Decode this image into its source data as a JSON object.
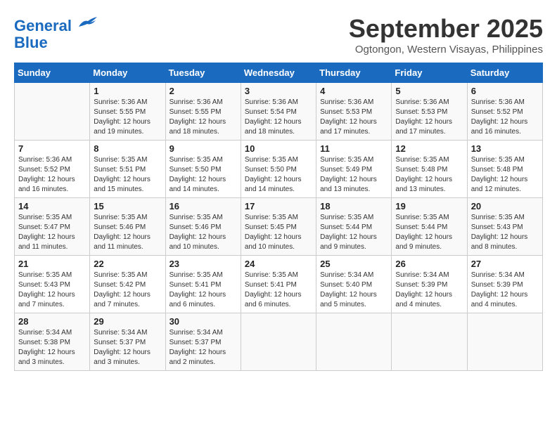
{
  "header": {
    "logo_line1": "General",
    "logo_line2": "Blue",
    "month_title": "September 2025",
    "location": "Ogtongon, Western Visayas, Philippines"
  },
  "days_of_week": [
    "Sunday",
    "Monday",
    "Tuesday",
    "Wednesday",
    "Thursday",
    "Friday",
    "Saturday"
  ],
  "weeks": [
    [
      {
        "day": "",
        "info": ""
      },
      {
        "day": "1",
        "info": "Sunrise: 5:36 AM\nSunset: 5:55 PM\nDaylight: 12 hours\nand 19 minutes."
      },
      {
        "day": "2",
        "info": "Sunrise: 5:36 AM\nSunset: 5:55 PM\nDaylight: 12 hours\nand 18 minutes."
      },
      {
        "day": "3",
        "info": "Sunrise: 5:36 AM\nSunset: 5:54 PM\nDaylight: 12 hours\nand 18 minutes."
      },
      {
        "day": "4",
        "info": "Sunrise: 5:36 AM\nSunset: 5:53 PM\nDaylight: 12 hours\nand 17 minutes."
      },
      {
        "day": "5",
        "info": "Sunrise: 5:36 AM\nSunset: 5:53 PM\nDaylight: 12 hours\nand 17 minutes."
      },
      {
        "day": "6",
        "info": "Sunrise: 5:36 AM\nSunset: 5:52 PM\nDaylight: 12 hours\nand 16 minutes."
      }
    ],
    [
      {
        "day": "7",
        "info": "Sunrise: 5:36 AM\nSunset: 5:52 PM\nDaylight: 12 hours\nand 16 minutes."
      },
      {
        "day": "8",
        "info": "Sunrise: 5:35 AM\nSunset: 5:51 PM\nDaylight: 12 hours\nand 15 minutes."
      },
      {
        "day": "9",
        "info": "Sunrise: 5:35 AM\nSunset: 5:50 PM\nDaylight: 12 hours\nand 14 minutes."
      },
      {
        "day": "10",
        "info": "Sunrise: 5:35 AM\nSunset: 5:50 PM\nDaylight: 12 hours\nand 14 minutes."
      },
      {
        "day": "11",
        "info": "Sunrise: 5:35 AM\nSunset: 5:49 PM\nDaylight: 12 hours\nand 13 minutes."
      },
      {
        "day": "12",
        "info": "Sunrise: 5:35 AM\nSunset: 5:48 PM\nDaylight: 12 hours\nand 13 minutes."
      },
      {
        "day": "13",
        "info": "Sunrise: 5:35 AM\nSunset: 5:48 PM\nDaylight: 12 hours\nand 12 minutes."
      }
    ],
    [
      {
        "day": "14",
        "info": "Sunrise: 5:35 AM\nSunset: 5:47 PM\nDaylight: 12 hours\nand 11 minutes."
      },
      {
        "day": "15",
        "info": "Sunrise: 5:35 AM\nSunset: 5:46 PM\nDaylight: 12 hours\nand 11 minutes."
      },
      {
        "day": "16",
        "info": "Sunrise: 5:35 AM\nSunset: 5:46 PM\nDaylight: 12 hours\nand 10 minutes."
      },
      {
        "day": "17",
        "info": "Sunrise: 5:35 AM\nSunset: 5:45 PM\nDaylight: 12 hours\nand 10 minutes."
      },
      {
        "day": "18",
        "info": "Sunrise: 5:35 AM\nSunset: 5:44 PM\nDaylight: 12 hours\nand 9 minutes."
      },
      {
        "day": "19",
        "info": "Sunrise: 5:35 AM\nSunset: 5:44 PM\nDaylight: 12 hours\nand 9 minutes."
      },
      {
        "day": "20",
        "info": "Sunrise: 5:35 AM\nSunset: 5:43 PM\nDaylight: 12 hours\nand 8 minutes."
      }
    ],
    [
      {
        "day": "21",
        "info": "Sunrise: 5:35 AM\nSunset: 5:43 PM\nDaylight: 12 hours\nand 7 minutes."
      },
      {
        "day": "22",
        "info": "Sunrise: 5:35 AM\nSunset: 5:42 PM\nDaylight: 12 hours\nand 7 minutes."
      },
      {
        "day": "23",
        "info": "Sunrise: 5:35 AM\nSunset: 5:41 PM\nDaylight: 12 hours\nand 6 minutes."
      },
      {
        "day": "24",
        "info": "Sunrise: 5:35 AM\nSunset: 5:41 PM\nDaylight: 12 hours\nand 6 minutes."
      },
      {
        "day": "25",
        "info": "Sunrise: 5:34 AM\nSunset: 5:40 PM\nDaylight: 12 hours\nand 5 minutes."
      },
      {
        "day": "26",
        "info": "Sunrise: 5:34 AM\nSunset: 5:39 PM\nDaylight: 12 hours\nand 4 minutes."
      },
      {
        "day": "27",
        "info": "Sunrise: 5:34 AM\nSunset: 5:39 PM\nDaylight: 12 hours\nand 4 minutes."
      }
    ],
    [
      {
        "day": "28",
        "info": "Sunrise: 5:34 AM\nSunset: 5:38 PM\nDaylight: 12 hours\nand 3 minutes."
      },
      {
        "day": "29",
        "info": "Sunrise: 5:34 AM\nSunset: 5:37 PM\nDaylight: 12 hours\nand 3 minutes."
      },
      {
        "day": "30",
        "info": "Sunrise: 5:34 AM\nSunset: 5:37 PM\nDaylight: 12 hours\nand 2 minutes."
      },
      {
        "day": "",
        "info": ""
      },
      {
        "day": "",
        "info": ""
      },
      {
        "day": "",
        "info": ""
      },
      {
        "day": "",
        "info": ""
      }
    ]
  ]
}
